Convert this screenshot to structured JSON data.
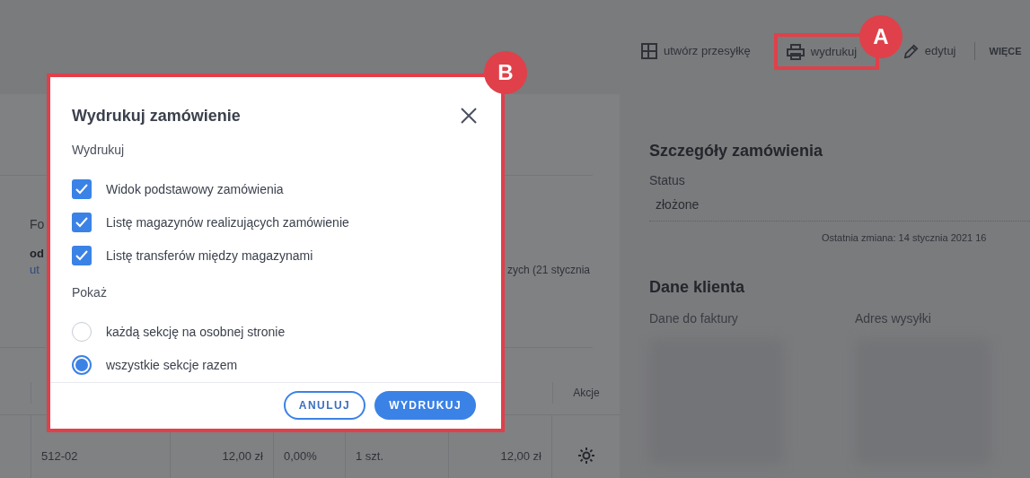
{
  "toolbar": {
    "items": [
      {
        "label": "utwórz przesyłkę",
        "kind": "table",
        "highlighted": false
      },
      {
        "label": "wydrukuj",
        "kind": "printer",
        "highlighted": true
      },
      {
        "label": "edytuj",
        "kind": "pencil",
        "highlighted": false
      }
    ],
    "more": "WIĘCE"
  },
  "order_info": {
    "label_fragment": "Fo",
    "name_fragment": "od",
    "link_fragment": "ut",
    "date_fragment": "zych (21 stycznia"
  },
  "table": {
    "actions_column": "Akcje",
    "rows": [
      {
        "cells": [
          "512-02",
          "12,00 zł",
          "0,00%",
          "1 szt.",
          "12,00 zł"
        ]
      }
    ]
  },
  "details": {
    "title": "Szczegóły zamówienia",
    "status_label": "Status",
    "status_value": "złożone",
    "last_change": "Ostatnia zmiana: 14 stycznia 2021 16"
  },
  "client": {
    "title": "Dane klienta",
    "billing_label": "Dane do faktury",
    "shipping_label": "Adres wysyłki"
  },
  "dialog": {
    "title": "Wydrukuj zamówienie",
    "print_label": "Wydrukuj",
    "options": [
      {
        "label": "Widok podstawowy zamówienia",
        "checked": true
      },
      {
        "label": "Listę magazynów realizujących zamówienie",
        "checked": true
      },
      {
        "label": "Listę transferów między magazynami",
        "checked": true
      }
    ],
    "show_label": "Pokaż",
    "layouts": [
      {
        "label": "każdą sekcję na osobnej stronie",
        "selected": false
      },
      {
        "label": "wszystkie sekcje razem",
        "selected": true
      }
    ],
    "buttons": [
      {
        "label": "ANULUJ",
        "kind": "secondary"
      },
      {
        "label": "WYDRUKUJ",
        "kind": "primary"
      }
    ]
  },
  "annotations": [
    {
      "label": "A"
    },
    {
      "label": "B"
    }
  ]
}
